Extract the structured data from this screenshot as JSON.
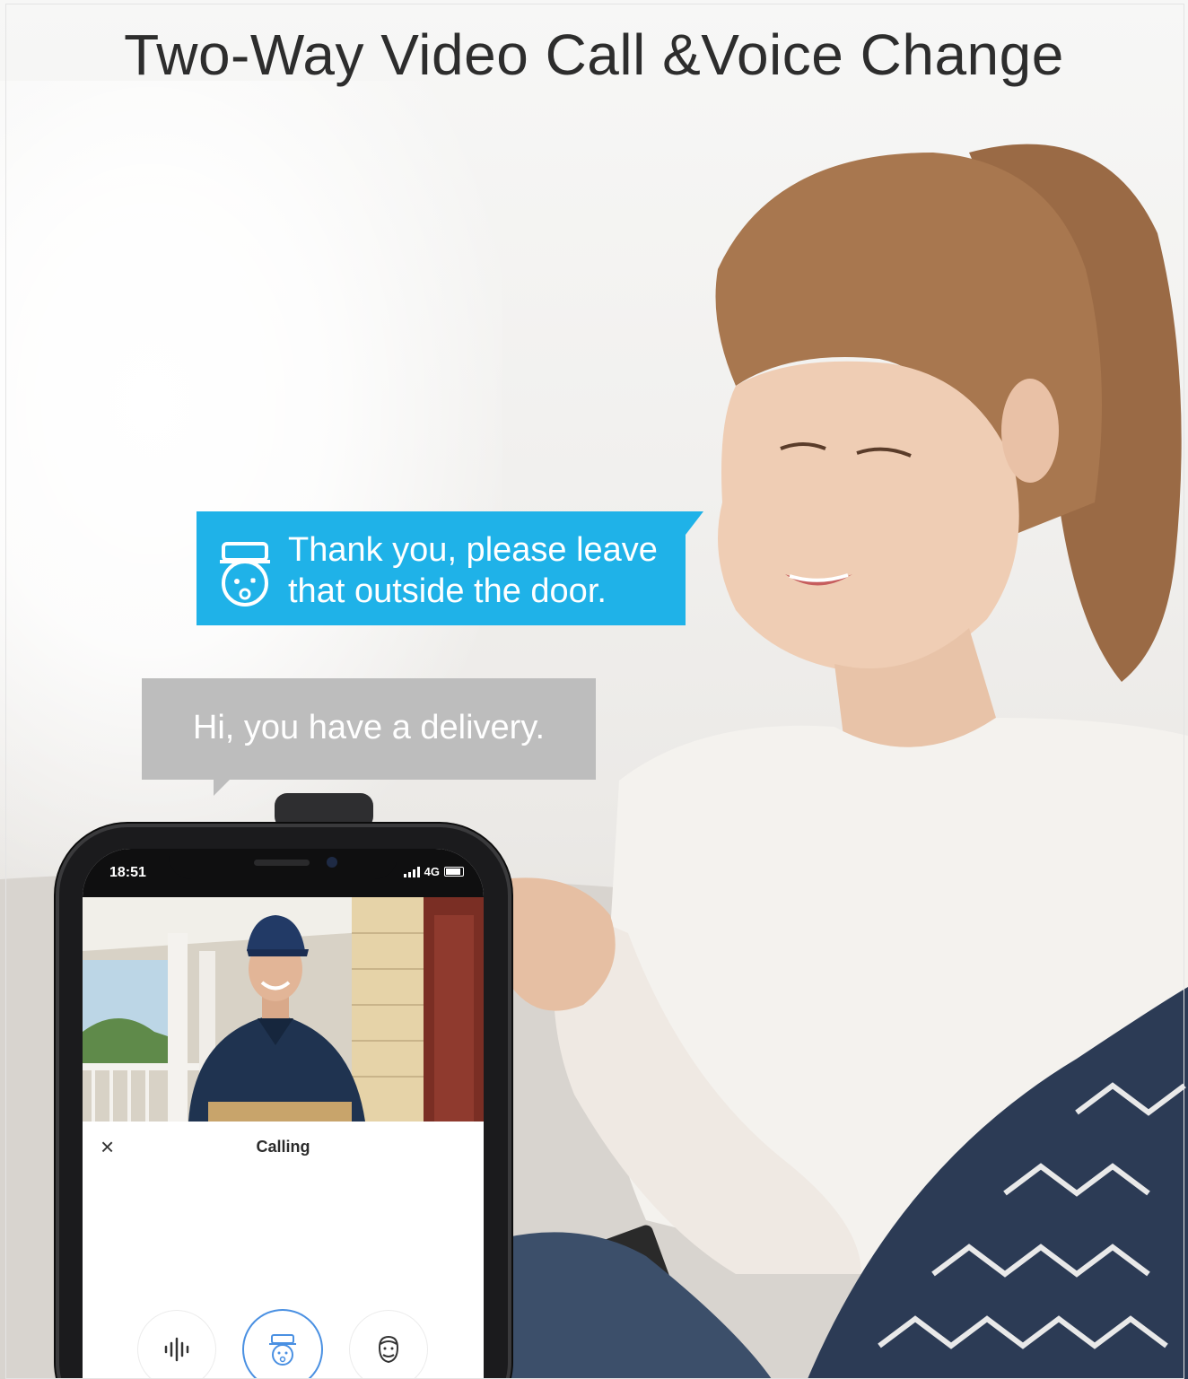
{
  "headline": "Two-Way Video Call &Voice Change",
  "bubbles": {
    "reply": "Thank you, please leave that outside the door.",
    "reply_line1": "Thank you, please leave",
    "reply_line2": "that outside the door.",
    "visitor": "Hi, you have a delivery."
  },
  "phone": {
    "status": {
      "time": "18:51",
      "network": "4G"
    },
    "call": {
      "close_glyph": "×",
      "status_label": "Calling"
    },
    "controls": [
      {
        "icon": "sound-wave-icon",
        "active": false
      },
      {
        "icon": "voice-changer-character-icon",
        "active": true
      },
      {
        "icon": "voice-changer-man-icon",
        "active": false
      }
    ]
  },
  "colors": {
    "bubble_blue": "#1fb2e8",
    "bubble_gray": "#bdbdbd",
    "accent_ring": "#4a90e2"
  }
}
